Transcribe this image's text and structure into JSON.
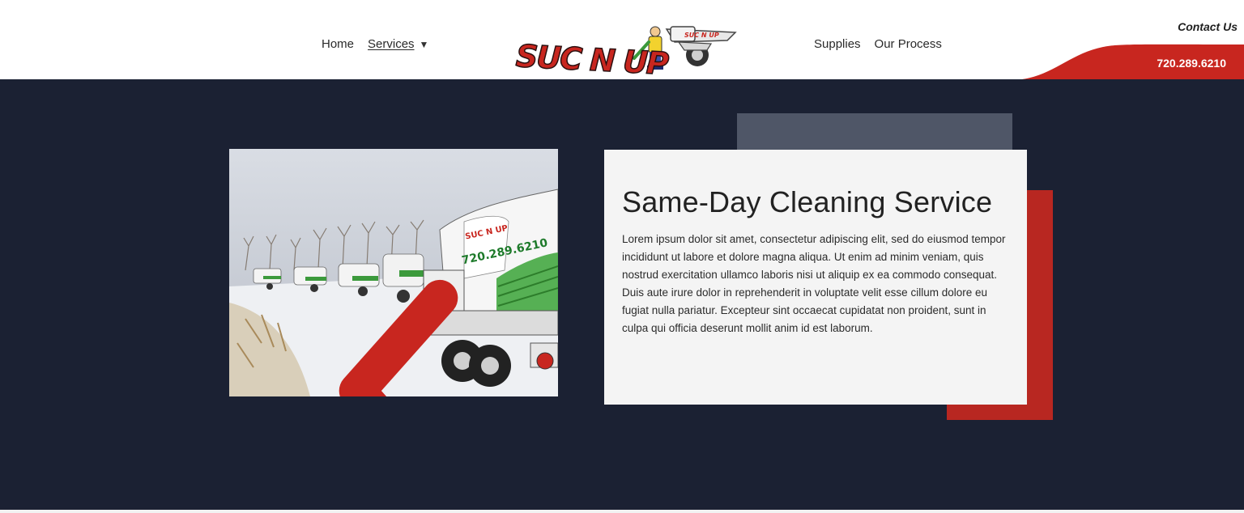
{
  "nav": {
    "left": [
      {
        "label": "Home"
      },
      {
        "label": "Services",
        "dropdown_icon": "triangle-down-icon"
      }
    ],
    "right": [
      {
        "label": "Supplies"
      },
      {
        "label": "Our Process"
      }
    ]
  },
  "logo": {
    "wordmark": "SUC N UP",
    "truck_text": "SUC N UP"
  },
  "contact": {
    "label": "Contact Us",
    "phone": "720.289.6210"
  },
  "hero": {
    "title": "Same-Day Cleaning Service",
    "body": "Lorem ipsum dolor sit amet, consectetur adipiscing elit, sed do eiusmod tempor incididunt ut labore et dolore magna aliqua. Ut enim ad minim veniam, quis nostrud exercitation ullamco laboris nisi ut aliquip ex ea commodo consequat. Duis aute irure dolor in reprehenderit in voluptate velit esse cillum dolore eu fugiat nulla pariatur. Excepteur sint occaecat cupidatat non proident, sunt in culpa qui officia deserunt mollit anim id est laborum.",
    "photo_icon": "truck-photo",
    "prev_icon": "chevron-left-icon"
  },
  "colors": {
    "brand_red": "#c8261f",
    "hero_bg": "#1b2133",
    "card_bg": "#f4f4f4",
    "deco_gray": "#4f5667"
  }
}
